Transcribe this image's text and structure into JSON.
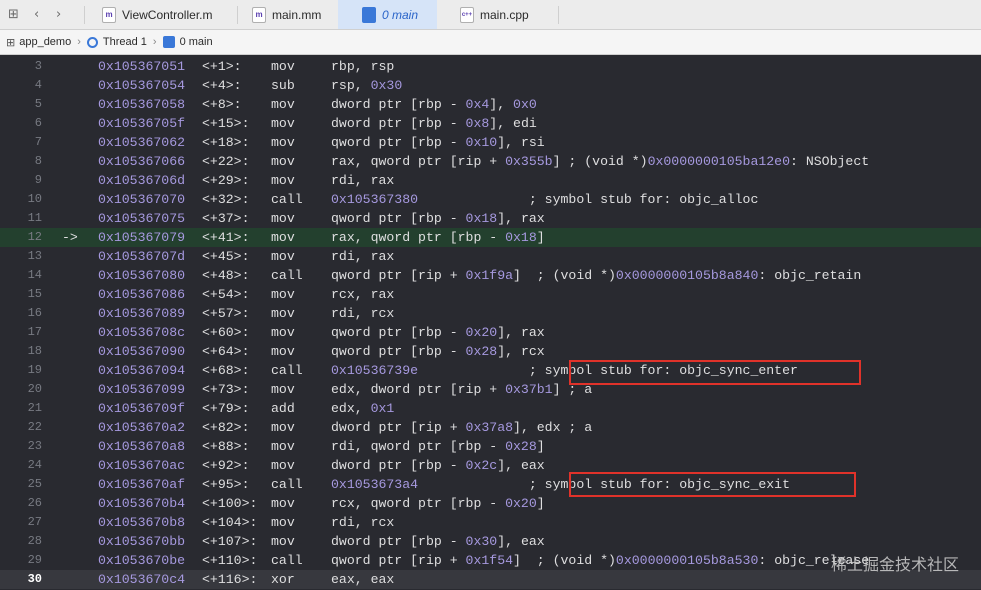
{
  "tabbar": {
    "grid_icon": "grid-icon",
    "tabs": [
      {
        "badge": "m",
        "label": "ViewController.m"
      },
      {
        "badge": "m",
        "label": "main.mm"
      },
      {
        "badge": "",
        "label": "0 main"
      },
      {
        "badge": "c++",
        "label": "main.cpp"
      }
    ]
  },
  "jumpbar": {
    "project": "app_demo",
    "thread": "Thread 1",
    "frame": "0 main"
  },
  "code": {
    "highlight_line": "12",
    "current_line": "30",
    "lines": [
      {
        "n": "3",
        "arrow": "",
        "addr": "0x105367051",
        "off": "<+1>:",
        "ins": "mov",
        "ops": [
          [
            "rbp, rsp",
            ""
          ]
        ]
      },
      {
        "n": "4",
        "arrow": "",
        "addr": "0x105367054",
        "off": "<+4>:",
        "ins": "sub",
        "ops": [
          [
            "rsp, ",
            ""
          ],
          [
            "0x30",
            "n"
          ]
        ]
      },
      {
        "n": "5",
        "arrow": "",
        "addr": "0x105367058",
        "off": "<+8>:",
        "ins": "mov",
        "ops": [
          [
            "dword ptr [rbp - ",
            ""
          ],
          [
            "0x4",
            "n"
          ],
          [
            "], ",
            ""
          ],
          [
            "0x0",
            "n"
          ]
        ]
      },
      {
        "n": "6",
        "arrow": "",
        "addr": "0x10536705f",
        "off": "<+15>:",
        "ins": "mov",
        "ops": [
          [
            "dword ptr [rbp - ",
            ""
          ],
          [
            "0x8",
            "n"
          ],
          [
            "], edi",
            ""
          ]
        ]
      },
      {
        "n": "7",
        "arrow": "",
        "addr": "0x105367062",
        "off": "<+18>:",
        "ins": "mov",
        "ops": [
          [
            "qword ptr [rbp - ",
            ""
          ],
          [
            "0x10",
            "n"
          ],
          [
            "], rsi",
            ""
          ]
        ]
      },
      {
        "n": "8",
        "arrow": "",
        "addr": "0x105367066",
        "off": "<+22>:",
        "ins": "mov",
        "ops": [
          [
            "rax, qword ptr [rip + ",
            ""
          ],
          [
            "0x355b",
            "n"
          ],
          [
            "] ; (void *)",
            ""
          ],
          [
            "0x0000000105ba12e0",
            "n"
          ],
          [
            ": NSObject",
            ""
          ]
        ]
      },
      {
        "n": "9",
        "arrow": "",
        "addr": "0x10536706d",
        "off": "<+29>:",
        "ins": "mov",
        "ops": [
          [
            "rdi, rax",
            ""
          ]
        ]
      },
      {
        "n": "10",
        "arrow": "",
        "addr": "0x105367070",
        "off": "<+32>:",
        "ins": "call",
        "ops": [
          [
            "0x105367380",
            "n"
          ],
          [
            "              ; symbol stub for: objc_alloc",
            ""
          ]
        ]
      },
      {
        "n": "11",
        "arrow": "",
        "addr": "0x105367075",
        "off": "<+37>:",
        "ins": "mov",
        "ops": [
          [
            "qword ptr [rbp - ",
            ""
          ],
          [
            "0x18",
            "n"
          ],
          [
            "], rax",
            ""
          ]
        ]
      },
      {
        "n": "12",
        "arrow": "->",
        "addr": "0x105367079",
        "off": "<+41>:",
        "ins": "mov",
        "ops": [
          [
            "rax, qword ptr [rbp - ",
            ""
          ],
          [
            "0x18",
            "n"
          ],
          [
            "]",
            ""
          ]
        ]
      },
      {
        "n": "13",
        "arrow": "",
        "addr": "0x10536707d",
        "off": "<+45>:",
        "ins": "mov",
        "ops": [
          [
            "rdi, rax",
            ""
          ]
        ]
      },
      {
        "n": "14",
        "arrow": "",
        "addr": "0x105367080",
        "off": "<+48>:",
        "ins": "call",
        "ops": [
          [
            "qword ptr [rip + ",
            ""
          ],
          [
            "0x1f9a",
            "n"
          ],
          [
            "]  ; (void *)",
            ""
          ],
          [
            "0x0000000105b8a840",
            "n"
          ],
          [
            ": objc_retain",
            ""
          ]
        ]
      },
      {
        "n": "15",
        "arrow": "",
        "addr": "0x105367086",
        "off": "<+54>:",
        "ins": "mov",
        "ops": [
          [
            "rcx, rax",
            ""
          ]
        ]
      },
      {
        "n": "16",
        "arrow": "",
        "addr": "0x105367089",
        "off": "<+57>:",
        "ins": "mov",
        "ops": [
          [
            "rdi, rcx",
            ""
          ]
        ]
      },
      {
        "n": "17",
        "arrow": "",
        "addr": "0x10536708c",
        "off": "<+60>:",
        "ins": "mov",
        "ops": [
          [
            "qword ptr [rbp - ",
            ""
          ],
          [
            "0x20",
            "n"
          ],
          [
            "], rax",
            ""
          ]
        ]
      },
      {
        "n": "18",
        "arrow": "",
        "addr": "0x105367090",
        "off": "<+64>:",
        "ins": "mov",
        "ops": [
          [
            "qword ptr [rbp - ",
            ""
          ],
          [
            "0x28",
            "n"
          ],
          [
            "], rcx",
            ""
          ]
        ]
      },
      {
        "n": "19",
        "arrow": "",
        "addr": "0x105367094",
        "off": "<+68>:",
        "ins": "call",
        "ops": [
          [
            "0x10536739e",
            "n"
          ],
          [
            "              ; symbol stub for: objc_sync_enter",
            ""
          ]
        ]
      },
      {
        "n": "20",
        "arrow": "",
        "addr": "0x105367099",
        "off": "<+73>:",
        "ins": "mov",
        "ops": [
          [
            "edx, dword ptr [rip + ",
            ""
          ],
          [
            "0x37b1",
            "n"
          ],
          [
            "] ; a",
            ""
          ]
        ]
      },
      {
        "n": "21",
        "arrow": "",
        "addr": "0x10536709f",
        "off": "<+79>:",
        "ins": "add",
        "ops": [
          [
            "edx, ",
            ""
          ],
          [
            "0x1",
            "n"
          ]
        ]
      },
      {
        "n": "22",
        "arrow": "",
        "addr": "0x1053670a2",
        "off": "<+82>:",
        "ins": "mov",
        "ops": [
          [
            "dword ptr [rip + ",
            ""
          ],
          [
            "0x37a8",
            "n"
          ],
          [
            "], edx ; a",
            ""
          ]
        ]
      },
      {
        "n": "23",
        "arrow": "",
        "addr": "0x1053670a8",
        "off": "<+88>:",
        "ins": "mov",
        "ops": [
          [
            "rdi, qword ptr [rbp - ",
            ""
          ],
          [
            "0x28",
            "n"
          ],
          [
            "]",
            ""
          ]
        ]
      },
      {
        "n": "24",
        "arrow": "",
        "addr": "0x1053670ac",
        "off": "<+92>:",
        "ins": "mov",
        "ops": [
          [
            "dword ptr [rbp - ",
            ""
          ],
          [
            "0x2c",
            "n"
          ],
          [
            "], eax",
            ""
          ]
        ]
      },
      {
        "n": "25",
        "arrow": "",
        "addr": "0x1053670af",
        "off": "<+95>:",
        "ins": "call",
        "ops": [
          [
            "0x1053673a4",
            "n"
          ],
          [
            "              ; symbol stub for: objc_sync_exit",
            ""
          ]
        ]
      },
      {
        "n": "26",
        "arrow": "",
        "addr": "0x1053670b4",
        "off": "<+100>:",
        "ins": "mov",
        "ops": [
          [
            "rcx, qword ptr [rbp - ",
            ""
          ],
          [
            "0x20",
            "n"
          ],
          [
            "]",
            ""
          ]
        ]
      },
      {
        "n": "27",
        "arrow": "",
        "addr": "0x1053670b8",
        "off": "<+104>:",
        "ins": "mov",
        "ops": [
          [
            "rdi, rcx",
            ""
          ]
        ]
      },
      {
        "n": "28",
        "arrow": "",
        "addr": "0x1053670bb",
        "off": "<+107>:",
        "ins": "mov",
        "ops": [
          [
            "dword ptr [rbp - ",
            ""
          ],
          [
            "0x30",
            "n"
          ],
          [
            "], eax",
            ""
          ]
        ]
      },
      {
        "n": "29",
        "arrow": "",
        "addr": "0x1053670be",
        "off": "<+110>:",
        "ins": "call",
        "ops": [
          [
            "qword ptr [rip + ",
            ""
          ],
          [
            "0x1f54",
            "n"
          ],
          [
            "]  ; (void *)",
            ""
          ],
          [
            "0x0000000105b8a530",
            "n"
          ],
          [
            ": objc_release",
            ""
          ]
        ]
      },
      {
        "n": "30",
        "arrow": "",
        "addr": "0x1053670c4",
        "off": "<+116>:",
        "ins": "xor",
        "ops": [
          [
            "eax, eax",
            ""
          ]
        ]
      }
    ]
  },
  "watermark": "稀土掘金技术社区",
  "colors": {
    "address": "#a699df",
    "highlight": "#23402e",
    "annotation_box": "#e0322a"
  }
}
